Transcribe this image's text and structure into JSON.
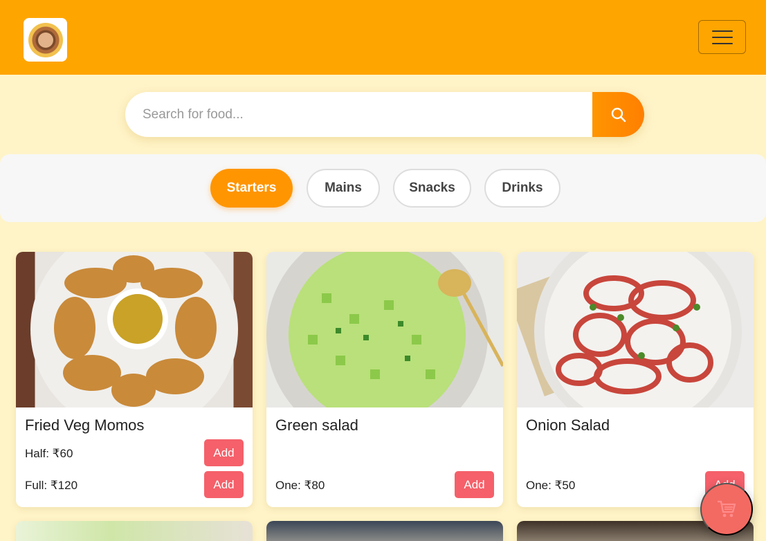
{
  "header": {
    "logo_alt": "Restaurant logo",
    "menu_icon": "hamburger-menu-icon",
    "brand_color": "#ffa500"
  },
  "search": {
    "placeholder": "Search for food...",
    "icon": "search-icon"
  },
  "tabs": [
    {
      "label": "Starters",
      "active": true
    },
    {
      "label": "Mains",
      "active": false
    },
    {
      "label": "Snacks",
      "active": false
    },
    {
      "label": "Drinks",
      "active": false
    }
  ],
  "items": [
    {
      "name": "Fried Veg Momos",
      "prices": [
        {
          "label": "Half: ₹60",
          "button": "Add"
        },
        {
          "label": "Full: ₹120",
          "button": "Add"
        }
      ]
    },
    {
      "name": "Green salad",
      "prices": [
        {
          "label": "One: ₹80",
          "button": "Add"
        }
      ]
    },
    {
      "name": "Onion Salad",
      "prices": [
        {
          "label": "One: ₹50",
          "button": "Add"
        }
      ]
    }
  ],
  "cart": {
    "icon": "cart-icon"
  },
  "colors": {
    "accent": "#ff9500",
    "add_button": "#f5606a",
    "cart_button": "#f36a62"
  }
}
